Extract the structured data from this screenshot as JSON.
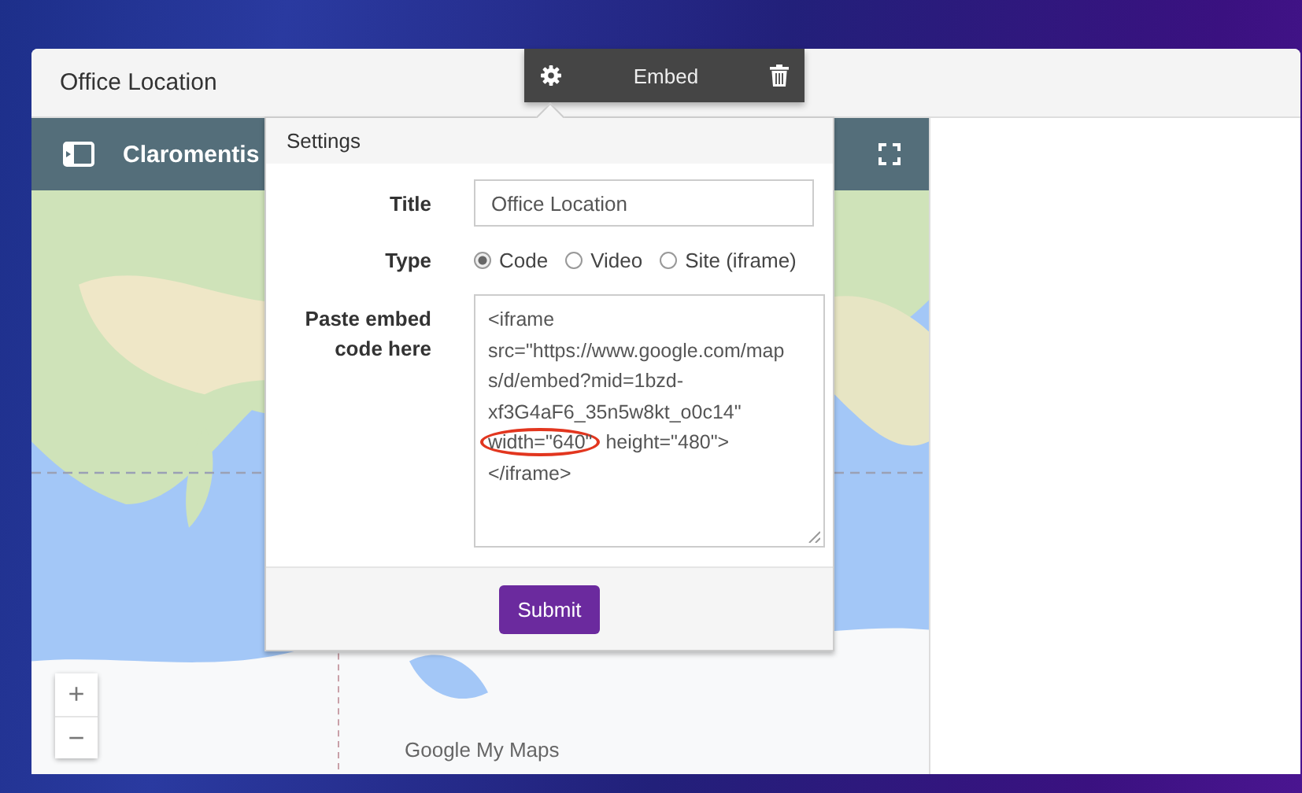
{
  "card": {
    "title": "Office Location"
  },
  "toolbar": {
    "label": "Embed"
  },
  "map": {
    "title": "Claromentis",
    "attribution": "Google My Maps",
    "zoom_in": "+",
    "zoom_out": "−"
  },
  "settings": {
    "title": "Settings",
    "title_field": {
      "label": "Title",
      "value": "Office Location"
    },
    "type": {
      "label": "Type",
      "options": [
        {
          "label": "Code",
          "selected": true
        },
        {
          "label": "Video",
          "selected": false
        },
        {
          "label": "Site (iframe)",
          "selected": false
        }
      ]
    },
    "embed_code": {
      "label": "Paste embed code here",
      "lines": [
        [
          {
            "text": "<iframe",
            "circled": false
          }
        ],
        [
          {
            "text": "src=\"https://www.google.com/map",
            "circled": false
          }
        ],
        [
          {
            "text": "s/d/embed?mid=1bzd-",
            "circled": false
          }
        ],
        [
          {
            "text": "xf3G4aF6_35n5w8kt_o0c14\"",
            "circled": false
          }
        ],
        [
          {
            "text": "width=\"640\"",
            "circled": true
          },
          {
            "text": " height=\"480\">",
            "circled": false
          }
        ],
        [
          {
            "text": "</iframe>",
            "circled": false
          }
        ]
      ]
    },
    "submit": "Submit"
  }
}
